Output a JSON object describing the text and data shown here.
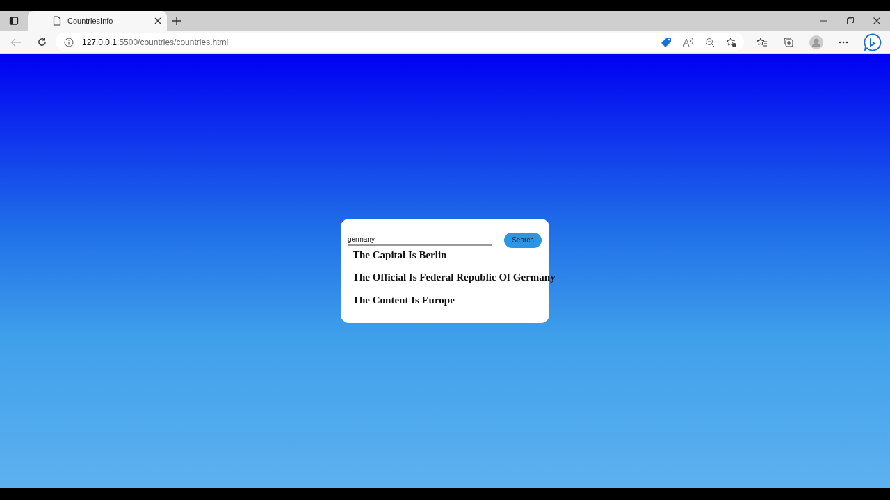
{
  "browser": {
    "tab": {
      "title": "CountriesInfo",
      "selected": true
    },
    "url": {
      "host": "127.0.0.1",
      "rest": ":5500/countries/countries.html"
    }
  },
  "search": {
    "value": "germany",
    "button": "Search"
  },
  "results": [
    "The Capital Is Berlin",
    "The Official Is Federal Republic Of Germany",
    "The Content Is Europe"
  ]
}
